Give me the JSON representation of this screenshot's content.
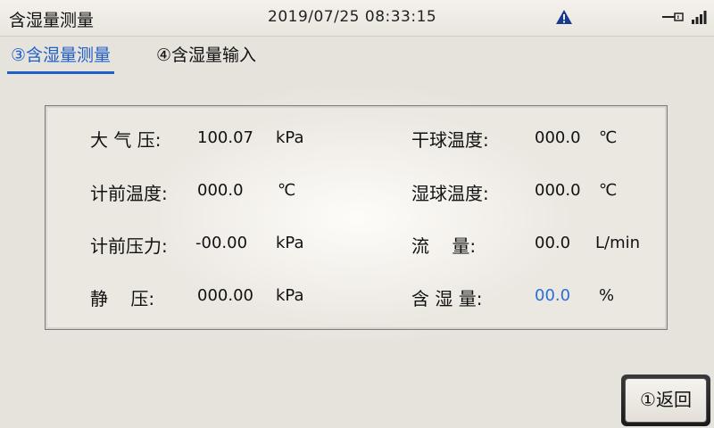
{
  "header": {
    "title": "含湿量测量",
    "datetime": "2019/07/25 08:33:15",
    "icons": {
      "warning": "warning-triangle-icon",
      "usb": "usb-icon",
      "signal": "signal-icon"
    },
    "colors": {
      "accent": "#1f5fc8",
      "warning": "#1a3a8f"
    }
  },
  "tabs": [
    {
      "label": "③含湿量测量",
      "active": true
    },
    {
      "label": "④含湿量输入",
      "active": false
    }
  ],
  "readings": {
    "atm_pressure": {
      "label": "大 气 压:",
      "value": "100.07",
      "unit": "kPa"
    },
    "meter_temp": {
      "label": "计前温度:",
      "value": "000.0",
      "unit": "℃"
    },
    "meter_pressure": {
      "label": "计前压力:",
      "value": "-00.00",
      "unit": "kPa"
    },
    "static_pressure": {
      "label": "静    压:",
      "value": "000.00",
      "unit": "kPa"
    },
    "dry_bulb": {
      "label": "干球温度:",
      "value": "000.0",
      "unit": "℃"
    },
    "wet_bulb": {
      "label": "湿球温度:",
      "value": "000.0",
      "unit": "℃"
    },
    "flow": {
      "label": "流    量:",
      "value": "00.0",
      "unit": "L/min"
    },
    "humidity": {
      "label": "含 湿 量:",
      "value": "00.0",
      "unit": "%"
    }
  },
  "back_button": {
    "label": "①返回"
  }
}
